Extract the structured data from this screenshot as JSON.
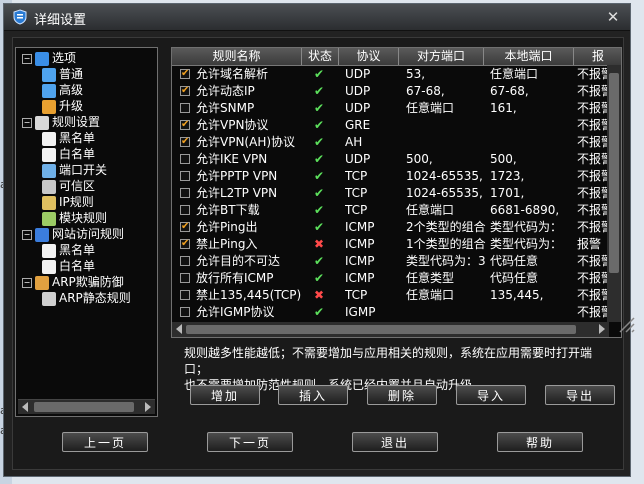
{
  "window": {
    "title": "详细设置",
    "close_glyph": "✕"
  },
  "tree": [
    {
      "label": "选项",
      "level": 0,
      "expander": "−",
      "icon": "gear-icon"
    },
    {
      "label": "普通",
      "level": 1,
      "icon": "gear-small-icon"
    },
    {
      "label": "高级",
      "level": 1,
      "icon": "gear-small-icon"
    },
    {
      "label": "升级",
      "level": 1,
      "icon": "upgrade-icon"
    },
    {
      "label": "规则设置",
      "level": 0,
      "expander": "−",
      "icon": "rules-icon"
    },
    {
      "label": "黑名单",
      "level": 1,
      "icon": "document-icon"
    },
    {
      "label": "白名单",
      "level": 1,
      "icon": "document-icon"
    },
    {
      "label": "端口开关",
      "level": 1,
      "icon": "port-icon"
    },
    {
      "label": "可信区",
      "level": 1,
      "icon": "network-icon"
    },
    {
      "label": "IP规则",
      "level": 1,
      "icon": "ip-icon"
    },
    {
      "label": "模块规则",
      "level": 1,
      "icon": "module-icon"
    },
    {
      "label": "网站访问规则",
      "level": 0,
      "expander": "−",
      "icon": "browser-icon"
    },
    {
      "label": "黑名单",
      "level": 1,
      "icon": "document-icon"
    },
    {
      "label": "白名单",
      "level": 1,
      "icon": "document-icon"
    },
    {
      "label": "ARP欺骗防御",
      "level": 0,
      "expander": "−",
      "icon": "arp-icon"
    },
    {
      "label": "ARP静态规则",
      "level": 1,
      "icon": "arp-static-icon"
    }
  ],
  "table": {
    "headers": [
      "规则名称",
      "状态",
      "协议",
      "对方端口",
      "本地端口",
      "报"
    ],
    "rows": [
      {
        "checked": true,
        "name": "允许域名解析",
        "status": "ok",
        "protocol": "UDP",
        "remote": "53,",
        "local": "任意端口",
        "action": "不报警"
      },
      {
        "checked": true,
        "name": "允许动态IP",
        "status": "ok",
        "protocol": "UDP",
        "remote": "67-68,",
        "local": "67-68,",
        "action": "不报警"
      },
      {
        "checked": false,
        "name": "允许SNMP",
        "status": "ok",
        "protocol": "UDP",
        "remote": "任意端口",
        "local": "161,",
        "action": "不报警"
      },
      {
        "checked": true,
        "name": "允许VPN协议",
        "status": "ok",
        "protocol": "GRE",
        "remote": "",
        "local": "",
        "action": "不报警"
      },
      {
        "checked": true,
        "name": "允许VPN(AH)协议",
        "status": "ok",
        "protocol": "AH",
        "remote": "",
        "local": "",
        "action": "不报警"
      },
      {
        "checked": false,
        "name": "允许IKE VPN",
        "status": "ok",
        "protocol": "UDP",
        "remote": "500,",
        "local": "500,",
        "action": "不报警"
      },
      {
        "checked": false,
        "name": "允许PPTP VPN",
        "status": "ok",
        "protocol": "TCP",
        "remote": "1024-65535,",
        "local": "1723,",
        "action": "不报警"
      },
      {
        "checked": false,
        "name": "允许L2TP VPN",
        "status": "ok",
        "protocol": "TCP",
        "remote": "1024-65535,",
        "local": "1701,",
        "action": "不报警"
      },
      {
        "checked": false,
        "name": "允许BT下载",
        "status": "ok",
        "protocol": "TCP",
        "remote": "任意端口",
        "local": "6681-6890,",
        "action": "不报警"
      },
      {
        "checked": true,
        "name": "允许Ping出",
        "status": "ok",
        "protocol": "ICMP",
        "remote": "2个类型的组合",
        "local": "类型代码为：",
        "action": "不报警"
      },
      {
        "checked": true,
        "name": "禁止Ping入",
        "status": "no",
        "protocol": "ICMP",
        "remote": "1个类型的组合",
        "local": "类型代码为：",
        "action": "报警"
      },
      {
        "checked": false,
        "name": "允许目的不可达",
        "status": "ok",
        "protocol": "ICMP",
        "remote": "类型代码为：3",
        "local": "代码任意",
        "action": "不报警"
      },
      {
        "checked": false,
        "name": "放行所有ICMP",
        "status": "ok",
        "protocol": "ICMP",
        "remote": "任意类型",
        "local": "代码任意",
        "action": "不报警"
      },
      {
        "checked": false,
        "name": "禁止135,445(TCP)",
        "status": "no",
        "protocol": "TCP",
        "remote": "任意端口",
        "local": "135,445,",
        "action": "不报警"
      },
      {
        "checked": false,
        "name": "允许IGMP协议",
        "status": "ok",
        "protocol": "IGMP",
        "remote": "",
        "local": "",
        "action": "不报警"
      }
    ]
  },
  "description": {
    "line1": "规则越多性能越低；不需要增加与应用相关的规则，系统在应用需要时打开端口；",
    "line2": "也不需要增加防范性规则，系统已经内置并且自动升级。"
  },
  "buttons": {
    "add": "增加",
    "insert": "插入",
    "delete": "删除",
    "import": "导入",
    "export": "导出",
    "prev": "上一页",
    "next": "下一页",
    "exit": "退出",
    "help": "帮助"
  },
  "colors": {
    "accent_check": "#f0a020",
    "status_ok": "#5ce05c",
    "status_no": "#ff4a4a"
  }
}
